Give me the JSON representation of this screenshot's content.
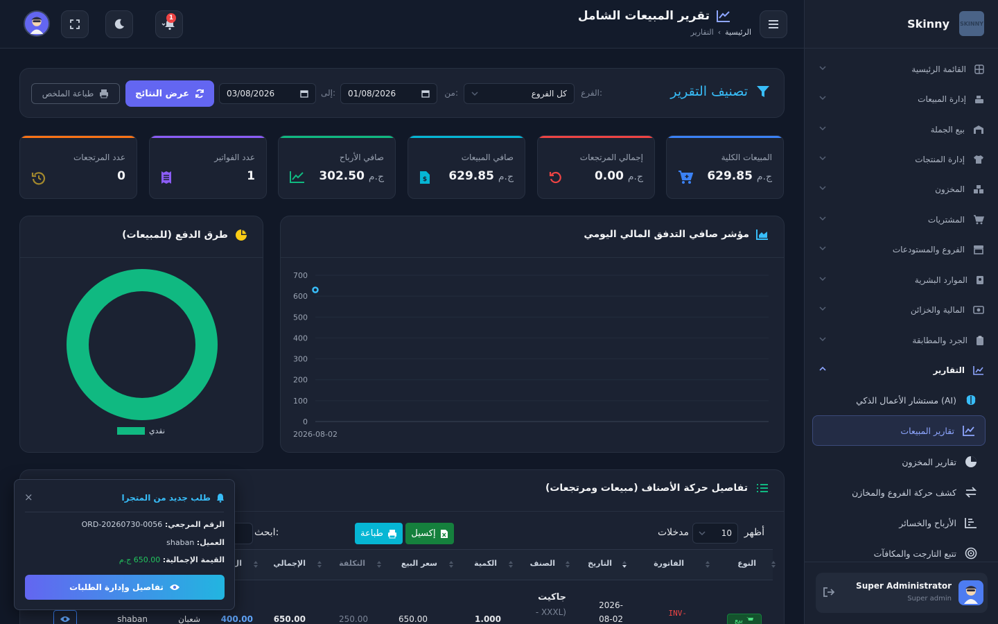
{
  "sidebar": {
    "brand": "Skinny",
    "logo_text": "SKINNY",
    "items": [
      {
        "label": "القائمة الرئيسية",
        "icon": "grid-icon"
      },
      {
        "label": "إدارة المبيعات",
        "icon": "cash-register-icon"
      },
      {
        "label": "بيع الجملة",
        "icon": "warehouse-icon"
      },
      {
        "label": "إدارة المنتجات",
        "icon": "shirt-icon"
      },
      {
        "label": "المخزون",
        "icon": "boxes-icon"
      },
      {
        "label": "المشتريات",
        "icon": "cart-icon"
      },
      {
        "label": "الفروع والمستودعات",
        "icon": "store-icon"
      },
      {
        "label": "الموارد البشرية",
        "icon": "id-badge-icon"
      },
      {
        "label": "المالية والخزائن",
        "icon": "money-icon"
      },
      {
        "label": "الجرد والمطابقة",
        "icon": "clipboard-icon"
      },
      {
        "label": "التقارير",
        "icon": "chart-line-icon"
      }
    ],
    "sub_items": [
      {
        "label": "مستشار الأعمال الذكي (AI)",
        "icon": "brain-icon"
      },
      {
        "label": "تقارير المبيعات",
        "icon": "chart-line-icon"
      },
      {
        "label": "تقارير المخزون",
        "icon": "pie-icon"
      },
      {
        "label": "كشف حركة الفروع والمخازن",
        "icon": "swap-icon"
      },
      {
        "label": "الأرباح والخسائر",
        "icon": "bar-chart-icon"
      },
      {
        "label": "تتبع التارجت والمكافآت",
        "icon": "target-icon"
      }
    ],
    "user": {
      "name": "Super Administrator",
      "role": "Super admin"
    }
  },
  "topbar": {
    "title": "تقرير المبيعات الشامل",
    "breadcrumb_home": "الرئيسية",
    "breadcrumb_current": "التقارير",
    "notification_count": "1"
  },
  "filter": {
    "title": "تصنيف التقرير",
    "branch_label": "الفرع:",
    "branch_value": "كل الفروع",
    "from_label": "من:",
    "from_value": "01/08/2026",
    "to_label": "إلى:",
    "to_value": "03/08/2026",
    "results_button": "عرض النتائج",
    "print_button": "طباعة الملخص"
  },
  "stats": [
    {
      "label": "المبيعات الكلية",
      "value": "629.85",
      "currency": "ج.م",
      "color": "#3b82f6",
      "icon": "cart-plus-icon"
    },
    {
      "label": "إجمالي المرتجعات",
      "value": "0.00",
      "currency": "ج.م",
      "color": "#ef4444",
      "icon": "undo-icon"
    },
    {
      "label": "صافي المبيعات",
      "value": "629.85",
      "currency": "ج.م",
      "color": "#06b6d4",
      "icon": "file-invoice-dollar-icon"
    },
    {
      "label": "صافي الأرباح",
      "value": "302.50",
      "currency": "ج.م",
      "color": "#10b981",
      "icon": "chart-line-icon"
    },
    {
      "label": "عدد الفواتير",
      "value": "1",
      "currency": "",
      "color": "#8b5cf6",
      "icon": "receipt-icon"
    },
    {
      "label": "عدد المرتجعات",
      "value": "0",
      "currency": "",
      "color": "#f97316",
      "icon": "history-icon"
    }
  ],
  "cashflow_chart": {
    "title": "مؤشر صافي التدفق المالي اليومي",
    "chart_data": {
      "type": "line",
      "x": [
        "2026-08-02"
      ],
      "series": [
        {
          "values": [
            629.85
          ]
        }
      ],
      "ylim": [
        0,
        700
      ],
      "yticks": [
        "0",
        "100",
        "200",
        "300",
        "400",
        "500",
        "600",
        "700"
      ],
      "xticks": [
        "2026-08-02"
      ],
      "grid": true,
      "color": "#38bdf8"
    }
  },
  "payment_chart": {
    "title": "طرق الدفع (للمبيعات)",
    "chart_data": {
      "type": "pie",
      "categories": [
        "نقدي"
      ],
      "values": [
        100
      ],
      "legend": "bottom",
      "color": "#10b981"
    }
  },
  "table": {
    "title": "تفاصيل حركة الأصناف (مبيعات ومرتجعات)",
    "show_label": "أظهر",
    "page_size": "10",
    "entries_label": "مدخلات",
    "excel_button": "إكسيل",
    "print_button": "طباعة",
    "search_label": "ابحث:",
    "columns": [
      "النوع",
      "الفاتورة",
      "التاريخ",
      "الصنف",
      "الكمية",
      "سعر البيع",
      "التكلفة",
      "الإجمالي",
      "ال"
    ],
    "row": {
      "type_badge": "بيع",
      "invoice": "INV-",
      "date_line1": "2026-",
      "date_line2": "08-02",
      "item": "جاكيت",
      "item_variant": "- XXXL)",
      "qty": "1.000",
      "price": "650.00",
      "cost": "250.00",
      "total": "650.00",
      "profit": "400.00",
      "month": "شعبان",
      "user": "shaban"
    }
  },
  "toast": {
    "title": "طلب جديد من المتجرا",
    "ref_label": "الرقم المرجعي:",
    "ref_value": "ORD-20260730-0056",
    "customer_label": "العميل:",
    "customer_value": "shaban",
    "total_label": "القيمة الإجمالية:",
    "total_value": "650.00 ج.م",
    "button": "تفاصيل وإدارة الطلبات",
    "close": "×"
  }
}
